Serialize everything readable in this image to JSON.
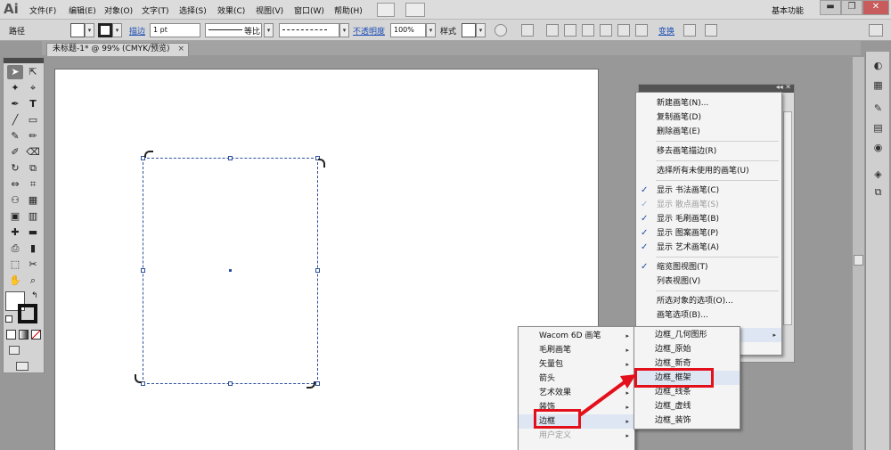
{
  "app": {
    "logo": "Ai",
    "workspace": "基本功能"
  },
  "menubar": {
    "items": [
      "文件(F)",
      "编辑(E)",
      "对象(O)",
      "文字(T)",
      "选择(S)",
      "效果(C)",
      "视图(V)",
      "窗口(W)",
      "帮助(H)"
    ]
  },
  "window_buttons": {
    "minimize": "▬",
    "restore": "❐",
    "close": "✕"
  },
  "controlbar": {
    "object_type": "路径",
    "stroke_label": "描边",
    "stroke_weight": "1 pt",
    "stroke_profile": "等比",
    "opacity_label": "不透明度",
    "opacity_value": "100%",
    "style_label": "样式",
    "transform_label": "变换"
  },
  "document": {
    "tab_title": "未标题-1* @ 99% (CMYK/预览)",
    "close_glyph": "×"
  },
  "tools": [
    "➤",
    "⇱",
    "✦",
    "⌖",
    "✒",
    "T",
    "╱",
    "▭",
    "✎",
    "✏",
    "✐",
    "⌫",
    "↻",
    "⧉",
    "⇔",
    "⌗",
    "⚇",
    "▦",
    "▣",
    "▥",
    "✚",
    "▬",
    "⎙",
    "▮",
    "⬚",
    "✂",
    "✋",
    "⌕"
  ],
  "brush_menu": {
    "items": [
      {
        "label": "新建画笔(N)...",
        "check": "",
        "disabled": false
      },
      {
        "label": "复制画笔(D)",
        "check": "",
        "disabled": false
      },
      {
        "label": "删除画笔(E)",
        "check": "",
        "disabled": false
      },
      {
        "label": "移去画笔描边(R)",
        "check": "",
        "disabled": false
      },
      {
        "label": "选择所有未使用的画笔(U)",
        "check": "",
        "disabled": false
      },
      {
        "label": "显示 书法画笔(C)",
        "check": "✓",
        "disabled": false
      },
      {
        "label": "显示 散点画笔(S)",
        "check": "✓",
        "disabled": true
      },
      {
        "label": "显示 毛刷画笔(B)",
        "check": "✓",
        "disabled": false
      },
      {
        "label": "显示 图案画笔(P)",
        "check": "✓",
        "disabled": false
      },
      {
        "label": "显示 艺术画笔(A)",
        "check": "✓",
        "disabled": false
      },
      {
        "label": "缩览图视图(T)",
        "check": "✓",
        "disabled": false
      },
      {
        "label": "列表视图(V)",
        "check": "",
        "disabled": false
      },
      {
        "label": "所选对象的选项(O)...",
        "check": "",
        "disabled": false
      },
      {
        "label": "画笔选项(B)...",
        "check": "",
        "disabled": false
      }
    ]
  },
  "library_menu": {
    "items": [
      {
        "label": "Wacom 6D 画笔",
        "arrow": "▸",
        "disabled": false
      },
      {
        "label": "毛刷画笔",
        "arrow": "▸",
        "disabled": false
      },
      {
        "label": "矢量包",
        "arrow": "▸",
        "disabled": false
      },
      {
        "label": "箭头",
        "arrow": "▸",
        "disabled": false
      },
      {
        "label": "艺术效果",
        "arrow": "▸",
        "disabled": false
      },
      {
        "label": "装饰",
        "arrow": "▸",
        "disabled": false
      },
      {
        "label": "边框",
        "arrow": "▸",
        "disabled": false
      },
      {
        "label": "用户定义",
        "arrow": "▸",
        "disabled": true
      }
    ]
  },
  "border_menu": {
    "items": [
      "边框_几何图形",
      "边框_原始",
      "边框_新奇",
      "边框_框架",
      "边框_线条",
      "边框_虚线",
      "边框_装饰"
    ]
  },
  "colors": {
    "annotation_red": "#e3101c",
    "selection_blue": "#2b4f9e",
    "check_blue": "#1f4fa6"
  }
}
